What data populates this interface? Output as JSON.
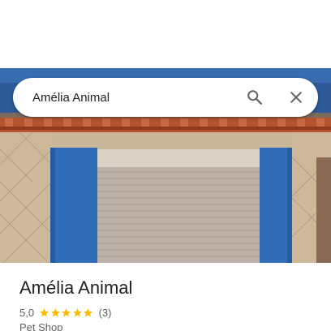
{
  "search": {
    "query": "Amélia Animal"
  },
  "place": {
    "name": "Amélia Animal",
    "rating": "5,0",
    "review_count": "(3)",
    "stars": 5,
    "category": "Pet Shop"
  },
  "colors": {
    "star": "#fbbc04",
    "text_primary": "#202124",
    "text_secondary": "#5f6368",
    "icon": "#5f6368"
  },
  "icons": {
    "search": "search-icon",
    "close": "close-icon",
    "star": "star-icon"
  }
}
